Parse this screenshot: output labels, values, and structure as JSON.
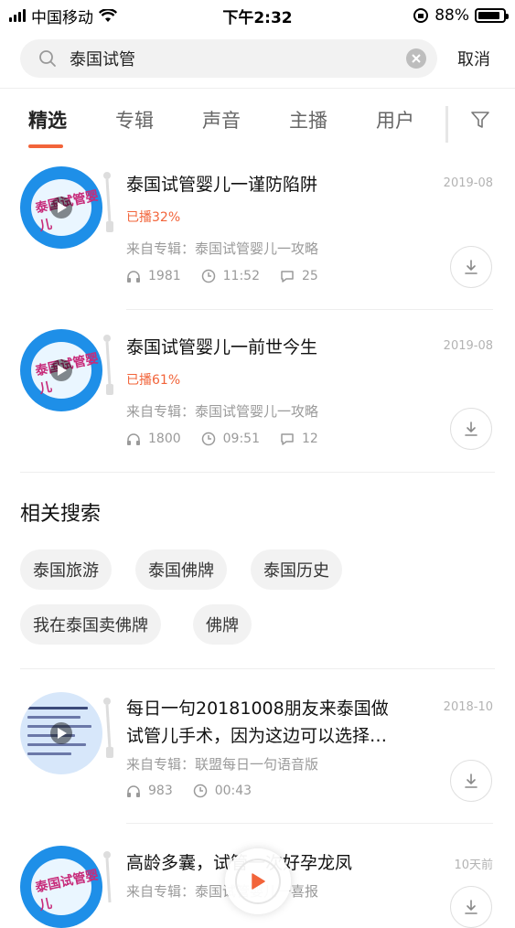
{
  "status_bar": {
    "carrier": "中国移动",
    "time": "下午2:32",
    "battery": "88%",
    "battery_level": 0.88
  },
  "search": {
    "query": "泰国试管",
    "cancel_label": "取消"
  },
  "tabs": [
    {
      "label": "精选",
      "active": true
    },
    {
      "label": "专辑",
      "active": false
    },
    {
      "label": "声音",
      "active": false
    },
    {
      "label": "主播",
      "active": false
    },
    {
      "label": "用户",
      "active": false
    }
  ],
  "results": [
    {
      "title": "泰国试管婴儿一谨防陷阱",
      "date": "2019-08",
      "played": "已播32%",
      "album": "来自专辑：泰国试管婴儿一攻略",
      "plays": "1981",
      "duration": "11:52",
      "comments": "25"
    },
    {
      "title": "泰国试管婴儿一前世今生",
      "date": "2019-08",
      "played": "已播61%",
      "album": "来自专辑：泰国试管婴儿一攻略",
      "plays": "1800",
      "duration": "09:51",
      "comments": "12"
    }
  ],
  "related": {
    "title": "相关搜索",
    "chips": [
      "泰国旅游",
      "泰国佛牌",
      "泰国历史",
      "我在泰国卖佛牌",
      "佛牌"
    ]
  },
  "results_more": [
    {
      "title_line1": "每日一句20181008朋友来泰国做",
      "title_line2": "试管儿手术，因为这边可以选择…",
      "date": "2018-10",
      "album": "来自专辑：联盟每日一句语音版",
      "plays": "983",
      "duration": "00:43"
    },
    {
      "title": "高龄多囊，试管一次好孕龙凤",
      "date": "10天前",
      "album": "来自专辑：泰国试管婴儿一喜报"
    }
  ],
  "cover_text": "泰国试管婴儿",
  "colors": {
    "accent": "#f2643a",
    "cover_blue": "#1e8fe8",
    "muted": "#9a9a9a"
  }
}
